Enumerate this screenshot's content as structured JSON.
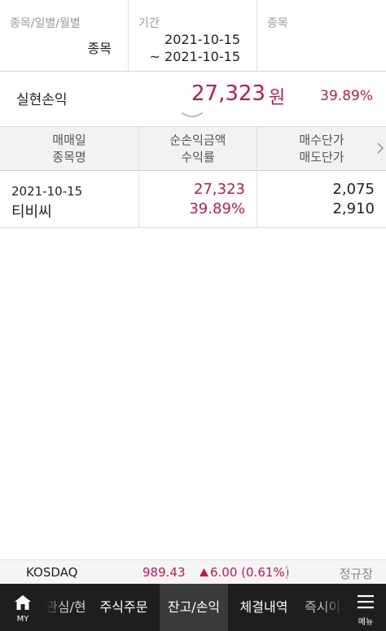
{
  "filters": {
    "type_label": "종목/일별/월별",
    "type_value": "종목",
    "period_label": "기간",
    "period_start": "2021-10-15",
    "period_end": "~ 2021-10-15",
    "stock_label": "종목"
  },
  "summary": {
    "label": "실현손익",
    "amount": "27,323",
    "unit": "원",
    "rate": "39.89%"
  },
  "table": {
    "headers": {
      "col1_line1": "매매일",
      "col1_line2": "종목명",
      "col2_line1": "순손익금액",
      "col2_line2": "수익률",
      "col3_line1": "매수단가",
      "col3_line2": "매도단가"
    },
    "rows": [
      {
        "date": "2021-10-15",
        "name": "티비씨",
        "pnl": "27,323",
        "rate": "39.89%",
        "buy_price": "2,075",
        "sell_price": "2,910"
      }
    ]
  },
  "ticker": {
    "index_name": "KOSDAQ",
    "price": "989.43",
    "change": "6.00 (0.61%)",
    "session": "정규장"
  },
  "nav": {
    "my_label": "MY",
    "tabs": [
      "관심/현재가/차트",
      "주식주문",
      "잔고/손익",
      "체결내역",
      "즉시이체"
    ],
    "active_tab": "잔고/손익",
    "menu_label": "메뉴"
  },
  "colors": {
    "accent_red": "#c2185b",
    "nav_bg": "#1e1e1e",
    "nav_active": "#3a3a3a"
  }
}
